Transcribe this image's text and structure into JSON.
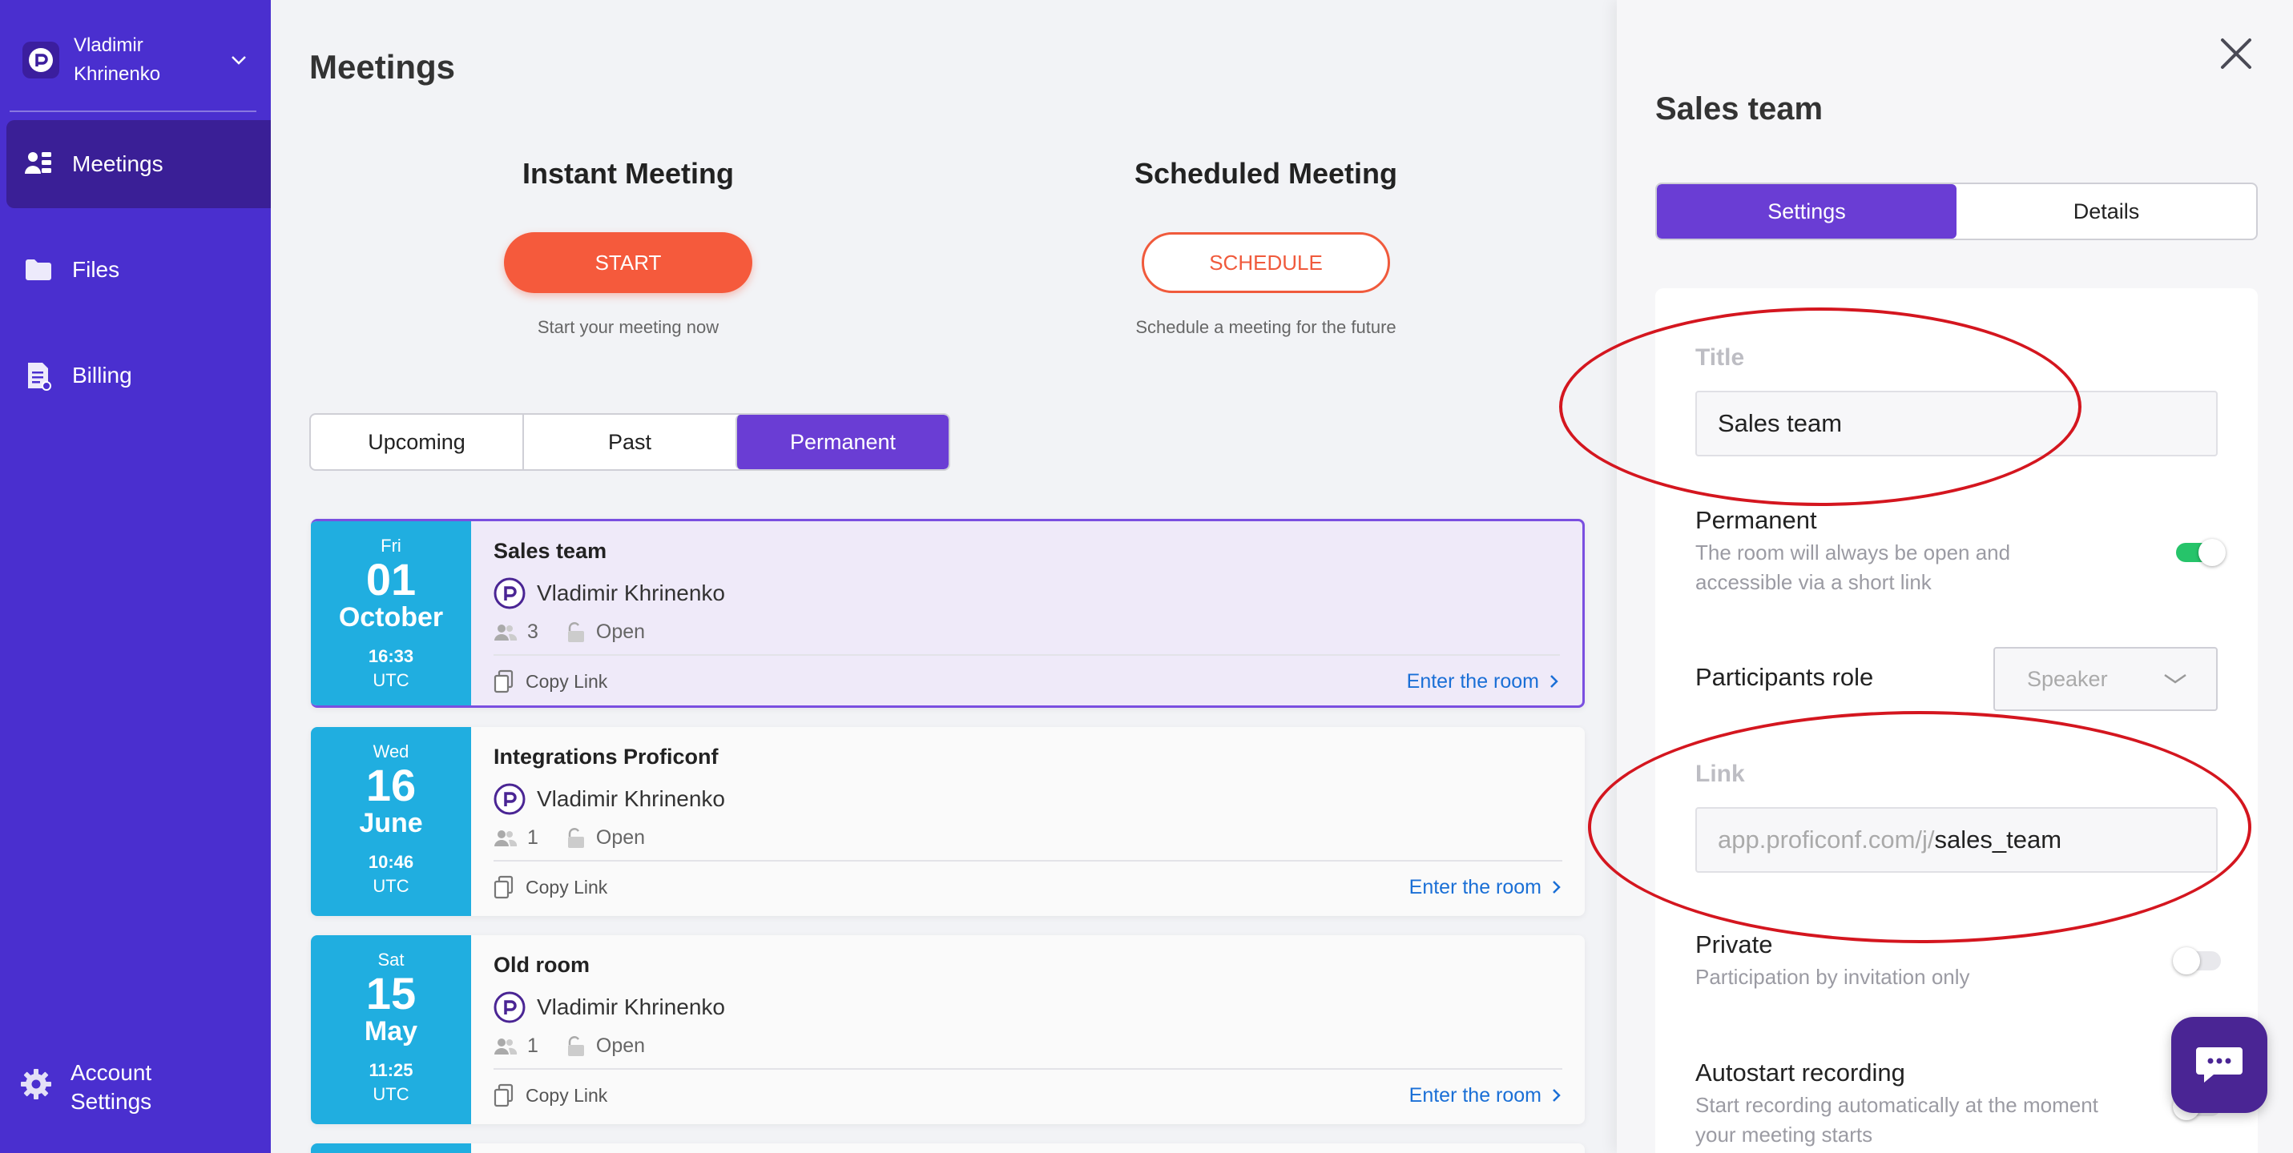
{
  "sidebar": {
    "user_name": "Vladimir Khrinenko",
    "items": [
      {
        "label": "Meetings",
        "icon": "meetings-icon"
      },
      {
        "label": "Files",
        "icon": "folder-icon"
      },
      {
        "label": "Billing",
        "icon": "billing-icon"
      }
    ],
    "account_label": "Account Settings"
  },
  "main": {
    "title": "Meetings",
    "instant": {
      "heading": "Instant Meeting",
      "button": "START",
      "caption": "Start your meeting now"
    },
    "scheduled": {
      "heading": "Scheduled Meeting",
      "button": "SCHEDULE",
      "caption": "Schedule a meeting for the future"
    },
    "tabs": [
      "Upcoming",
      "Past",
      "Permanent"
    ],
    "active_tab": "Permanent",
    "meetings": [
      {
        "dow": "Fri",
        "day": "01",
        "month": "October",
        "time": "16:33",
        "tz": "UTC",
        "title": "Sales team",
        "owner": "Vladimir Khrinenko",
        "participants": "3",
        "access": "Open",
        "copy": "Copy Link",
        "enter": "Enter the room"
      },
      {
        "dow": "Wed",
        "day": "16",
        "month": "June",
        "time": "10:46",
        "tz": "UTC",
        "title": "Integrations Proficonf",
        "owner": "Vladimir Khrinenko",
        "participants": "1",
        "access": "Open",
        "copy": "Copy Link",
        "enter": "Enter the room"
      },
      {
        "dow": "Sat",
        "day": "15",
        "month": "May",
        "time": "11:25",
        "tz": "UTC",
        "title": "Old room",
        "owner": "Vladimir Khrinenko",
        "participants": "1",
        "access": "Open",
        "copy": "Copy Link",
        "enter": "Enter the room"
      }
    ]
  },
  "panel": {
    "title": "Sales team",
    "tabs": [
      "Settings",
      "Details"
    ],
    "title_label": "Title",
    "title_value": "Sales team",
    "permanent": {
      "title": "Permanent",
      "desc": "The room will always be open and accessible via a short link",
      "on": true
    },
    "role": {
      "label": "Participants role",
      "value": "Speaker"
    },
    "link_label": "Link",
    "link_prefix": "app.proficonf.com/j/",
    "link_slug": "sales_team",
    "private": {
      "title": "Private",
      "desc": "Participation by invitation only",
      "on": false
    },
    "autostart": {
      "title": "Autostart recording",
      "desc": "Start recording automatically at the moment your meeting starts",
      "on": false
    }
  },
  "colors": {
    "sidebar": "#4a2fcf",
    "accent": "#6a3dd4",
    "start": "#f55a3c",
    "date_bg": "#20aee0",
    "annotation": "#d4161f",
    "link": "#1a6fd6"
  }
}
